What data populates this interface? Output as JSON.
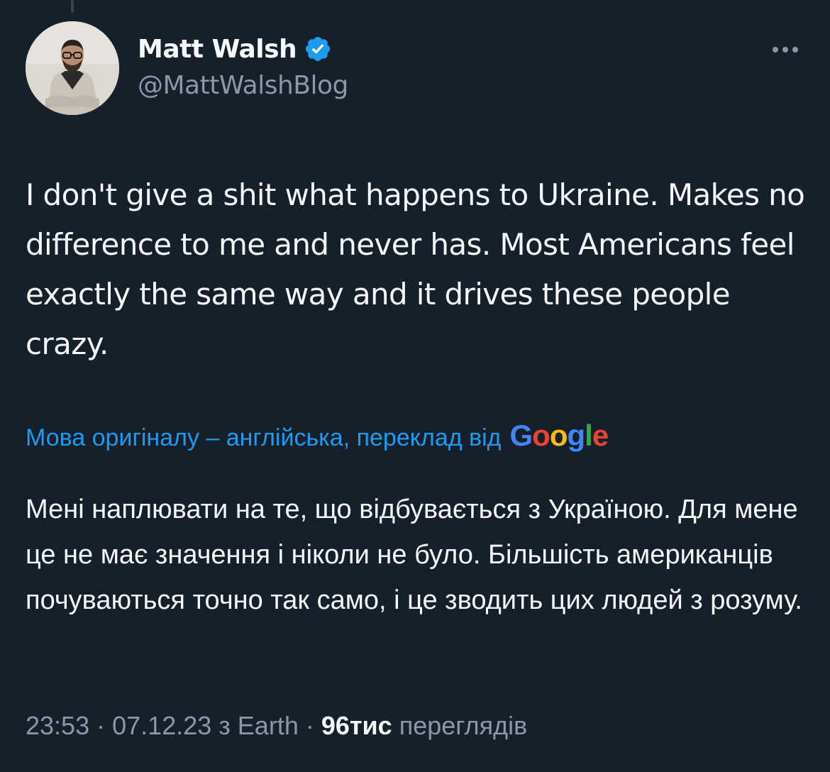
{
  "author": {
    "display_name": "Matt Walsh",
    "handle": "@MattWalshBlog",
    "verified": true,
    "verified_color": "#1d9bf0"
  },
  "tweet": {
    "text": "I don't give a shit what happens to Ukraine. Makes no difference to me and never has. Most Americans feel exactly the same way and it drives these people crazy.",
    "translation_note": "Мова оригіналу – англійська, переклад від",
    "translation_provider": "Google",
    "translated_text": "Мені наплювати на те, що відбувається з Україною. Для мене це не має значення і ніколи не було. Більшість американців почуваються точно так само, і це зводить цих людей з розуму."
  },
  "meta": {
    "time": "23:53",
    "separator": "·",
    "date": "07.12.23",
    "source": "з Earth",
    "views_count": "96тис",
    "views_label": "переглядів"
  },
  "icons": {
    "more": "more-horizontal-icon",
    "verified": "verified-badge-icon"
  },
  "colors": {
    "background": "#15202b",
    "text_primary": "#f7f9f9",
    "text_secondary": "#8b98a5",
    "link": "#1d9bf0",
    "google_blue": "#4285f4",
    "google_red": "#ea4335",
    "google_yellow": "#fbbc05",
    "google_green": "#34a853"
  }
}
